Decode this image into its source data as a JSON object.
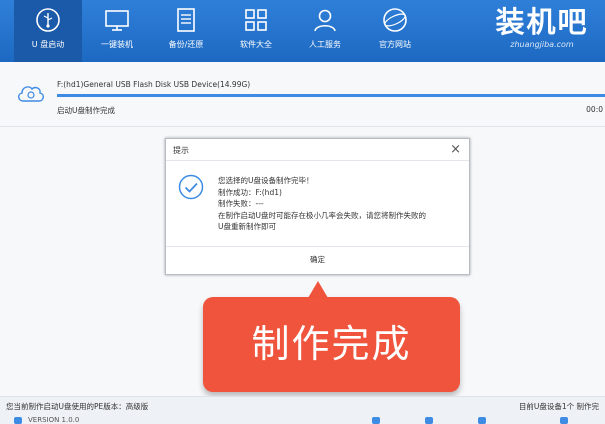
{
  "nav": {
    "items": [
      {
        "label": "U 盘启动",
        "icon": "usb-power-icon"
      },
      {
        "label": "一键装机",
        "icon": "monitor-icon"
      },
      {
        "label": "备份/还原",
        "icon": "document-icon"
      },
      {
        "label": "软件大全",
        "icon": "grid-icon"
      },
      {
        "label": "人工服务",
        "icon": "person-icon"
      },
      {
        "label": "官方网站",
        "icon": "globe-icon"
      }
    ],
    "brand_logo": "装机吧",
    "brand_url": "zhuangjiba.com"
  },
  "device": {
    "name": "F:(hd1)General USB Flash Disk USB Device(14.99G)",
    "status": "启动U盘制作完成",
    "time": "00:0",
    "progress": 1.0
  },
  "dialog": {
    "title": "提示",
    "close_glyph": "×",
    "lines": [
      "您选择的U盘设备制作完毕！",
      "制作成功：F:(hd1)",
      "制作失败：---",
      "在制作启动U盘时可能存在极小几率会失败，请您将制作失败的",
      "U盘重新制作即可"
    ],
    "confirm_label": "确定"
  },
  "callout": {
    "text": "制作完成"
  },
  "statusbar": {
    "left": "您当前制作启动U盘使用的PE版本：高级版",
    "right": "目前U盘设备1个 制作完",
    "version": "VERSION 1.0.0"
  },
  "colors": {
    "nav_bg": "#2f7fd8",
    "nav_active": "#1a5aa9",
    "accent": "#3d8be3",
    "callout": "#f0543d"
  }
}
